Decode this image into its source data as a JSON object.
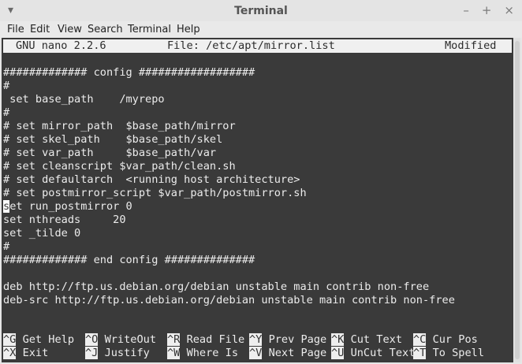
{
  "window": {
    "title": "Terminal",
    "left_control": "▾",
    "controls": [
      "–",
      "+",
      "×"
    ]
  },
  "menu": {
    "items": [
      "File",
      "Edit",
      "View",
      "Search",
      "Terminal",
      "Help"
    ]
  },
  "nano": {
    "version": "GNU nano 2.2.6",
    "file": "File: /etc/apt/mirror.list",
    "status": "Modified",
    "lines": [
      "############# config ##################",
      "#",
      " set base_path    /myrepo",
      "#",
      "# set mirror_path  $base_path/mirror",
      "# set skel_path    $base_path/skel",
      "# set var_path     $base_path/var",
      "# set cleanscript $var_path/clean.sh",
      "# set defaultarch  <running host architecture>",
      "# set postmirror_script $var_path/postmirror.sh",
      "set run_postmirror 0",
      "set nthreads     20",
      "set _tilde 0",
      "#",
      "############# end config ##############",
      "",
      "deb http://ftp.us.debian.org/debian unstable main contrib non-free",
      "deb-src http://ftp.us.debian.org/debian unstable main contrib non-free"
    ],
    "cursor_line": 10,
    "shortcuts": [
      {
        "key": "^G",
        "label": "Get Help"
      },
      {
        "key": "^O",
        "label": "WriteOut"
      },
      {
        "key": "^R",
        "label": "Read File"
      },
      {
        "key": "^Y",
        "label": "Prev Page"
      },
      {
        "key": "^K",
        "label": "Cut Text"
      },
      {
        "key": "^C",
        "label": "Cur Pos"
      },
      {
        "key": "^X",
        "label": "Exit"
      },
      {
        "key": "^J",
        "label": "Justify"
      },
      {
        "key": "^W",
        "label": "Where Is"
      },
      {
        "key": "^V",
        "label": "Next Page"
      },
      {
        "key": "^U",
        "label": "UnCut Text"
      },
      {
        "key": "^T",
        "label": "To Spell"
      }
    ]
  }
}
